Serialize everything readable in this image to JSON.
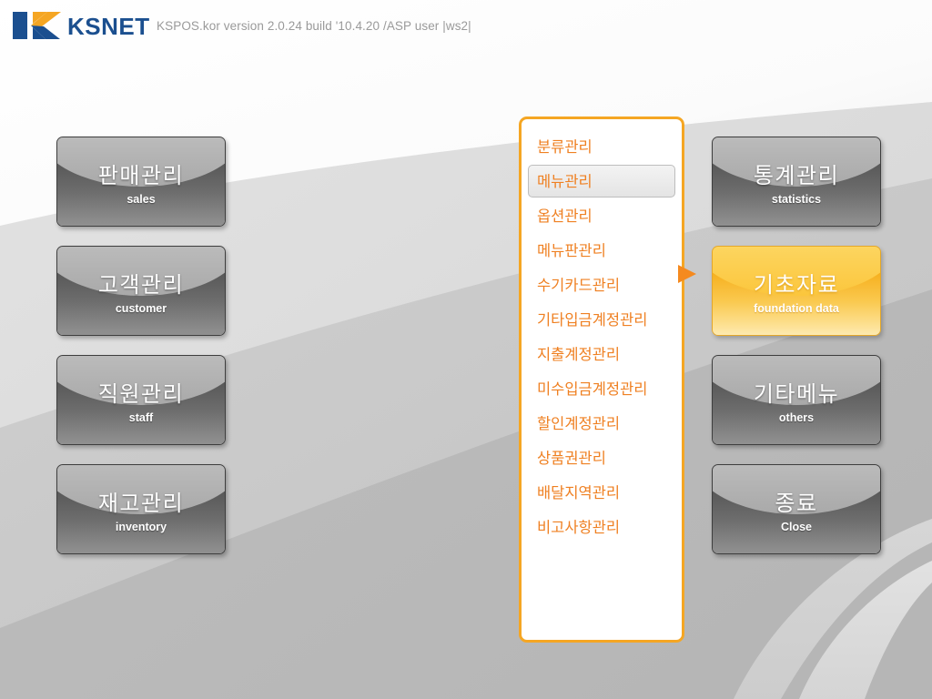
{
  "header": {
    "logo_text": "KSNET",
    "logo_icon": "ksnet-k-logo",
    "version_text": "KSPOS.kor version 2.0.24 build '10.4.20 /ASP user |ws2|"
  },
  "colors": {
    "accent_orange": "#f5a623",
    "menu_text_orange": "#ef8022",
    "logo_blue": "#1b4f8f",
    "logo_orange": "#f5a623",
    "button_gray_top": "#4f4f4f",
    "button_gray_bottom": "#909090",
    "button_arc_gray": "#bdbdbd",
    "highlight_orange_top": "#f4a50c",
    "highlight_orange_bottom": "#fdeab2",
    "version_text_gray": "#9a9a9a",
    "background_gray": "#bcbcbc"
  },
  "left_buttons": [
    {
      "ko": "판매관리",
      "en": "sales",
      "highlighted": false
    },
    {
      "ko": "고객관리",
      "en": "customer",
      "highlighted": false
    },
    {
      "ko": "직원관리",
      "en": "staff",
      "highlighted": false
    },
    {
      "ko": "재고관리",
      "en": "inventory",
      "highlighted": false
    }
  ],
  "right_buttons": [
    {
      "ko": "통계관리",
      "en": "statistics",
      "highlighted": false
    },
    {
      "ko": "기초자료",
      "en": "foundation data",
      "highlighted": true
    },
    {
      "ko": "기타메뉴",
      "en": "others",
      "highlighted": false
    },
    {
      "ko": "종료",
      "en": "Close",
      "highlighted": false
    }
  ],
  "menu_panel": {
    "selected_index": 1,
    "items": [
      {
        "label": "분류관리"
      },
      {
        "label": "메뉴관리"
      },
      {
        "label": "옵션관리"
      },
      {
        "label": "메뉴판관리"
      },
      {
        "label": "수기카드관리"
      },
      {
        "label": "기타입금계정관리"
      },
      {
        "label": "지출계정관리"
      },
      {
        "label": "미수입금계정관리"
      },
      {
        "label": "할인계정관리"
      },
      {
        "label": "상품권관리"
      },
      {
        "label": "배달지역관리"
      },
      {
        "label": "비고사항관리"
      }
    ]
  },
  "arrow": {
    "icon": "triangle-right-icon"
  }
}
